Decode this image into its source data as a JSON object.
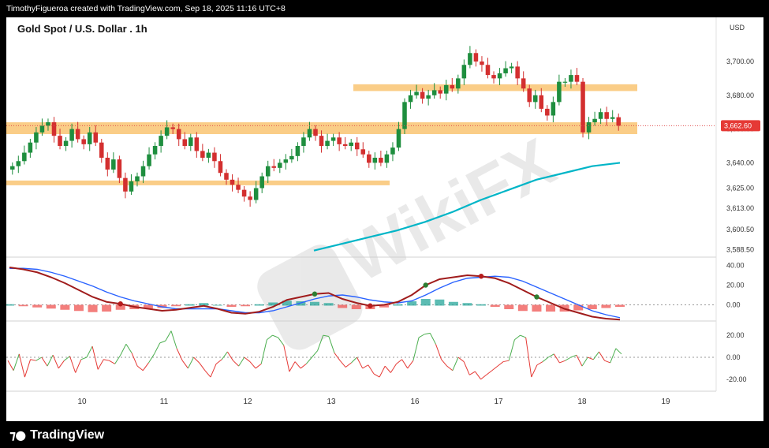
{
  "header": {
    "attribution": "TimothyFigueroa created with TradingView.com, Sep 18, 2025 11:16 UTC+8"
  },
  "chart_data": {
    "type": "candlestick",
    "title": "Gold Spot / U.S. Dollar . 1h",
    "currency": "USD",
    "last_price_label": "3,662.60",
    "x_tick_labels": [
      "10",
      "11",
      "12",
      "13",
      "16",
      "17",
      "18",
      "19"
    ],
    "price_axis": {
      "ticks": [
        3700.0,
        3680.0,
        3660.0,
        3640.0,
        3625.0,
        3613.0,
        3600.5,
        3588.5
      ],
      "tick_labels": [
        "3,700.00",
        "3,680.00",
        "3,660.00",
        "3,640.00",
        "3,625.00",
        "3,613.00",
        "3,600.50",
        "3,588.50"
      ],
      "range": [
        3586,
        3714
      ]
    },
    "support_resistance_zones": [
      {
        "low": 3627.5,
        "high": 3629.5
      },
      {
        "low": 3657,
        "high": 3664
      },
      {
        "low": 3682.5,
        "high": 3686.5
      }
    ],
    "closes": [
      3638,
      3641,
      3646,
      3652,
      3658,
      3662,
      3664,
      3656,
      3650,
      3653,
      3660,
      3654,
      3651,
      3658,
      3652,
      3643,
      3636,
      3642,
      3631,
      3623,
      3629,
      3632,
      3638,
      3645,
      3650,
      3656,
      3661,
      3660,
      3654,
      3650,
      3655,
      3647,
      3643,
      3646,
      3641,
      3634,
      3630,
      3627,
      3624,
      3620,
      3618,
      3625,
      3632,
      3638,
      3637,
      3640,
      3642,
      3644,
      3650,
      3655,
      3660,
      3656,
      3650,
      3653,
      3655,
      3651,
      3650,
      3652,
      3648,
      3645,
      3640,
      3643,
      3640,
      3645,
      3649,
      3660,
      3676,
      3680,
      3682,
      3678,
      3680,
      3683,
      3681,
      3686,
      3684,
      3690,
      3698,
      3705,
      3700,
      3698,
      3692,
      3690,
      3693,
      3696,
      3697,
      3690,
      3684,
      3676,
      3680,
      3672,
      3668,
      3676,
      3688,
      3688,
      3692,
      3688,
      3658,
      3664,
      3666,
      3670,
      3666,
      3667,
      3662
    ],
    "ma_series": {
      "color": "#00b5c7",
      "values": [
        3588,
        3592,
        3596,
        3600,
        3605,
        3611,
        3618,
        3624,
        3630,
        3634,
        3638,
        3640
      ]
    },
    "oscillator_1": {
      "axis_ticks": [
        40.0,
        20.0,
        0.0
      ],
      "tick_labels": [
        "40.00",
        "20.00",
        "0.00"
      ],
      "fast": [
        38,
        36,
        33,
        28,
        22,
        15,
        8,
        3,
        1,
        -2,
        -4,
        -6,
        -5,
        -3,
        -1,
        -4,
        -8,
        -9,
        -7,
        -2,
        5,
        8,
        11,
        12,
        6,
        2,
        -1,
        0,
        3,
        10,
        20,
        26,
        28,
        30,
        29,
        27,
        22,
        15,
        8,
        2,
        -4,
        -8,
        -12,
        -14,
        -15
      ],
      "slow": [
        37,
        37,
        36,
        33,
        29,
        24,
        19,
        13,
        8,
        4,
        1,
        -2,
        -4,
        -4,
        -4,
        -4,
        -6,
        -8,
        -8,
        -6,
        -2,
        2,
        6,
        9,
        10,
        8,
        5,
        3,
        2,
        4,
        10,
        17,
        23,
        27,
        28,
        29,
        28,
        24,
        18,
        12,
        6,
        0,
        -6,
        -10,
        -13
      ]
    },
    "oscillator_2": {
      "axis_ticks": [
        20.0,
        0.0,
        -20.0
      ],
      "tick_labels": [
        "20.00",
        "0.00",
        "-20.00"
      ],
      "values": [
        -3,
        -12,
        3,
        -18,
        -2,
        -3,
        0,
        -8,
        2,
        -10,
        -3,
        1,
        -14,
        -2,
        0,
        10,
        -11,
        -2,
        -3,
        -6,
        2,
        12,
        4,
        -8,
        -12,
        -5,
        3,
        13,
        15,
        24,
        8,
        -3,
        -10,
        0,
        -5,
        -12,
        -18,
        -6,
        -2,
        5,
        -3,
        -8,
        0,
        -4,
        -10,
        -6,
        16,
        20,
        18,
        11,
        -13,
        -4,
        -10,
        -6,
        0,
        6,
        20,
        19,
        4,
        -3,
        -9,
        -5,
        0,
        -10,
        -7,
        -15,
        -18,
        -8,
        -14,
        -6,
        -2,
        -10,
        -3,
        18,
        21,
        22,
        12,
        -2,
        -8,
        -12,
        0,
        -4,
        -16,
        -13,
        -20,
        -16,
        -12,
        -8,
        -4,
        -3,
        16,
        20,
        18,
        -18,
        -7,
        -4,
        0,
        3,
        -5,
        -3,
        0,
        2,
        -8,
        0,
        -2,
        5,
        -3,
        -5,
        8,
        3
      ]
    }
  }
}
